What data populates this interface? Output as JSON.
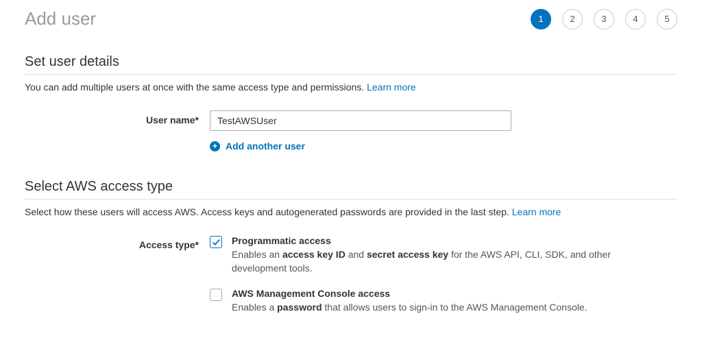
{
  "page_title": "Add user",
  "stepper": [
    "1",
    "2",
    "3",
    "4",
    "5"
  ],
  "active_step": 1,
  "user_details": {
    "title": "Set user details",
    "desc_prefix": "You can add multiple users at once with the same access type and permissions. ",
    "learn_more": "Learn more",
    "username_label": "User name*",
    "username_value": "TestAWSUser",
    "add_another_label": "Add another user"
  },
  "access_type": {
    "title": "Select AWS access type",
    "desc_prefix": "Select how these users will access AWS. Access keys and autogenerated passwords are provided in the last step. ",
    "learn_more": "Learn more",
    "label": "Access type*",
    "programmatic": {
      "checked": true,
      "title": "Programmatic access",
      "desc_before": "Enables an ",
      "bold1": "access key ID",
      "desc_middle": " and ",
      "bold2": "secret access key",
      "desc_after": " for the AWS API, CLI, SDK, and other development tools."
    },
    "console": {
      "checked": false,
      "title": "AWS Management Console access",
      "desc_before": "Enables a ",
      "bold1": "password",
      "desc_after": " that allows users to sign-in to the AWS Management Console."
    }
  }
}
